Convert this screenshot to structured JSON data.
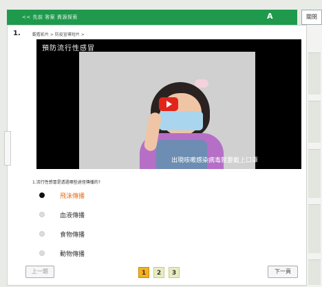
{
  "topbar": {
    "nav": "<< 先前 答案 資源探索",
    "marker": "A",
    "right_button": "關閉"
  },
  "question_block": {
    "number": "1.",
    "breadcrumb": "觀看影片 > 防疫宣導短片 >",
    "video": {
      "title": "預防流行性感冒",
      "subtitle": "出現咳嗽感染病毒就要戴上口罩"
    },
    "prompt": "1.流行性感冒是透過哪些途徑傳播的?",
    "options": [
      {
        "label": "飛沫傳播",
        "selected": true
      },
      {
        "label": "血液傳播",
        "selected": false
      },
      {
        "label": "食物傳播",
        "selected": false
      },
      {
        "label": "動物傳播",
        "selected": false
      }
    ]
  },
  "pagination": {
    "prev_label": "上一題",
    "next_label": "下一頁",
    "pages": [
      "1",
      "2",
      "3"
    ],
    "current_page": "1"
  },
  "colors": {
    "accent_green": "#1f9a4d",
    "selected_option": "#e07020",
    "active_page": "#f4b120"
  }
}
